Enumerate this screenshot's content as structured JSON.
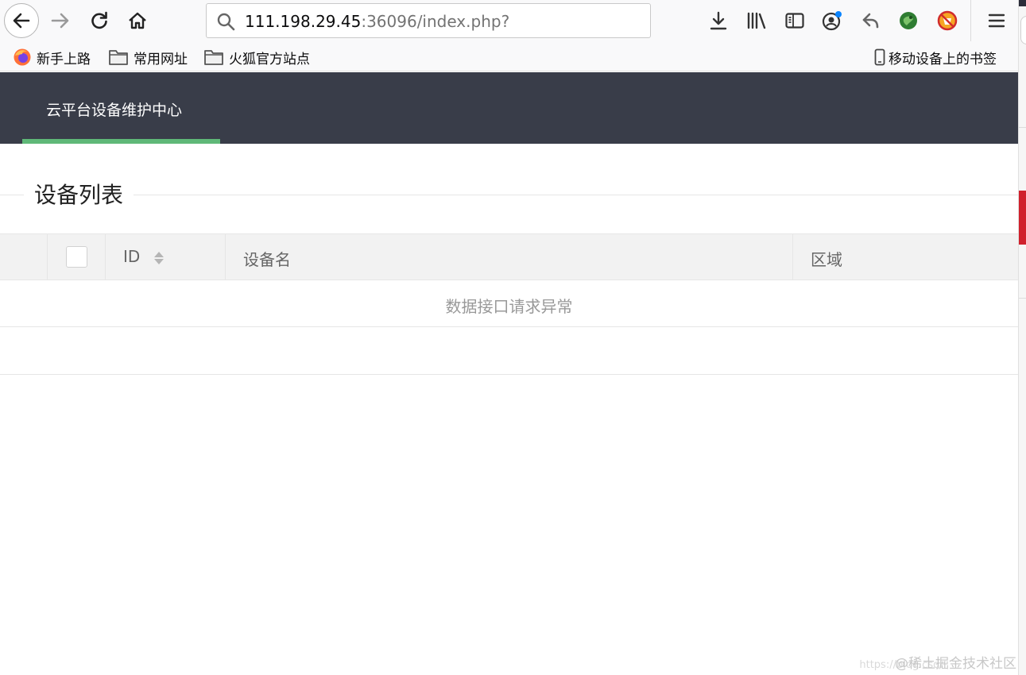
{
  "browser": {
    "url_host": "111.198.29.45",
    "url_rest": ":36096/index.php?",
    "bookmarks": [
      {
        "label": "新手上路",
        "icon": "firefox-icon"
      },
      {
        "label": "常用网址",
        "icon": "folder-icon"
      },
      {
        "label": "火狐官方站点",
        "icon": "folder-icon"
      }
    ],
    "mobile_bookmarks": "移动设备上的书签"
  },
  "app": {
    "nav_title": "云平台设备维护中心",
    "accent_color": "#5fb878",
    "header_color": "#393d49"
  },
  "section": {
    "title": "设备列表"
  },
  "table": {
    "columns": {
      "id": "ID",
      "device_name": "设备名",
      "region": "区域"
    },
    "empty_message": "数据接口请求异常"
  },
  "watermark": {
    "faint": "https://blog.csdn",
    "text": "@稀土掘金技术社区"
  }
}
